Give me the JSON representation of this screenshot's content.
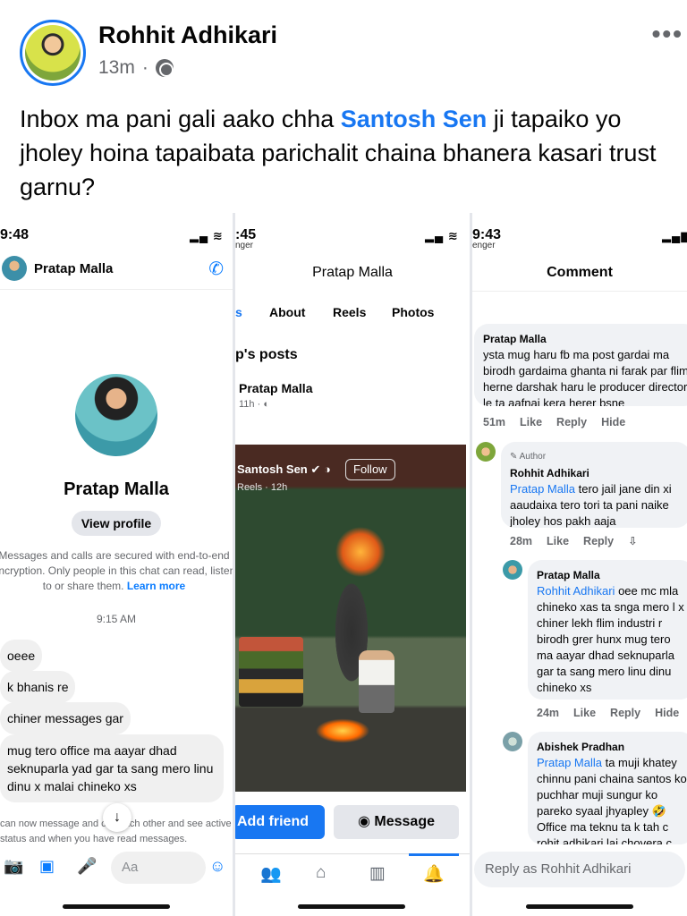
{
  "post": {
    "author": "Rohhit Adhikari",
    "time": "13m",
    "separator": "·",
    "more": "•••",
    "text_before": "Inbox ma pani gali aako chha ",
    "mention": "Santosh Sen",
    "text_after": " ji tapaiko yo jholey hoina tapaibata parichalit chaina bhanera kasari trust garnu?"
  },
  "messenger": {
    "status_time": "9:48",
    "contact": "Pratap Malla",
    "profile_name": "Pratap Malla",
    "view_profile": "View profile",
    "secure_text": "Messages and calls are secured with end-to-end encryption. Only people in this chat can read, listen to or share them.",
    "learn_more": "Learn more",
    "chat_time": "9:15 AM",
    "messages": [
      "oeee",
      "k bhanis re",
      "chiner messages gar",
      "mug tero office ma aayar dhad seknuparla yad gar ta sang mero linu dinu x malai chineko xs"
    ],
    "bottom_note": "can now message and call each other and see active status and when you have read messages.",
    "compose_placeholder": "Aa"
  },
  "profile": {
    "status_time": ":45",
    "status_sub": "nger",
    "title": "Pratap Malla",
    "tabs": [
      "s",
      "About",
      "Reels",
      "Photos"
    ],
    "posts_heading": "p's posts",
    "post_author": "Pratap Malla",
    "post_meta": "11h · ",
    "reel_author": "Santosh Sen",
    "reel_meta": "Reels · 12h",
    "follow": "Follow",
    "add_friend": "Add friend",
    "message": "Message"
  },
  "comments": {
    "status_time": "9:43",
    "status_sub": "enger",
    "title": "Comment",
    "items": [
      {
        "name": "Pratap Malla",
        "text": "ysta mug haru fb ma post gardai ma birodh gardaima ghanta ni farak par flim herne darshak haru le producer director le ta aafnai kera herer bsne",
        "time": "51m"
      },
      {
        "name": "Rohhit Adhikari",
        "author_tag": "Author",
        "mention": "Pratap Malla",
        "text": " tero jail jane din xi aaudaixa tero tori ta pani naike jholey hos pakh aaja",
        "time": "28m"
      },
      {
        "name": "Pratap Malla",
        "mention": "Rohhit Adhikari",
        "text": " oee mc mla chineko xas ta snga mero l x chiner lekh flim industri r birodh grer hunx mug tero ma aayar dhad seknuparla gar ta sang mero linu dinu chineko xs",
        "time": "24m"
      },
      {
        "name": "Abishek Pradhan",
        "mention": "Pratap Malla",
        "text": " ta muji khatey chinnu pani chaina santos ko puchhar muji sungur ko pareko syaal jhyapley 🤣 Office ma teknu ta k tah c rohit adhikari lai chovera c",
        "time": ""
      }
    ],
    "actions": {
      "like": "Like",
      "reply": "Reply",
      "hide": "Hide"
    },
    "reply_placeholder": "Reply as Rohhit Adhikari"
  }
}
